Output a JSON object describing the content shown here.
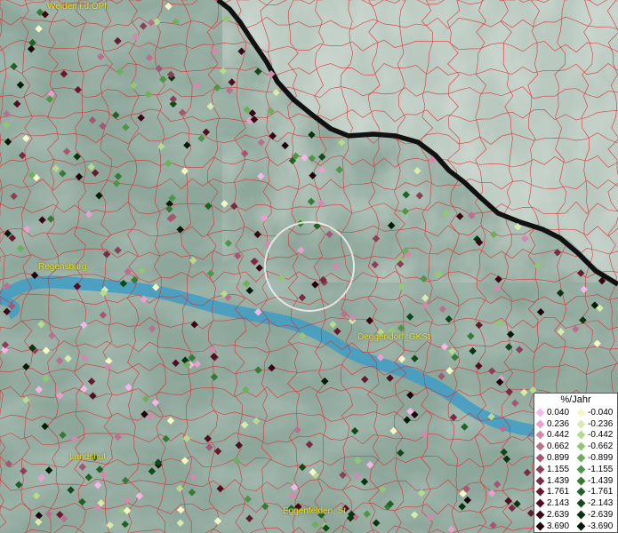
{
  "map": {
    "cities": [
      {
        "name": "Weiden i.d.OPf",
        "id": "weiden"
      },
      {
        "name": "Regensburg",
        "id": "regensburg"
      },
      {
        "name": "Deggendorf_GKSt",
        "id": "deggendorf"
      },
      {
        "name": "Landshut",
        "id": "landshut"
      },
      {
        "name": "Eggenfelden, St",
        "id": "eggenfelden"
      }
    ]
  },
  "legend": {
    "title": "%/Jahr",
    "positive": [
      {
        "label": "0.040",
        "color": "#f3b8e8"
      },
      {
        "label": "0.236",
        "color": "#e8a1cf"
      },
      {
        "label": "0.442",
        "color": "#d18aae"
      },
      {
        "label": "0.662",
        "color": "#bb6f8f"
      },
      {
        "label": "0.899",
        "color": "#a45672"
      },
      {
        "label": "1.155",
        "color": "#8e3f58"
      },
      {
        "label": "1.439",
        "color": "#7a2a42"
      },
      {
        "label": "1.761",
        "color": "#661a30"
      },
      {
        "label": "2.143",
        "color": "#500e20"
      },
      {
        "label": "2.639",
        "color": "#3a0614"
      },
      {
        "label": "3.690",
        "color": "#20020a"
      }
    ],
    "negative": [
      {
        "label": "-0.040",
        "color": "#f5f8c4"
      },
      {
        "label": "-0.236",
        "color": "#d9ebaa"
      },
      {
        "label": "-0.442",
        "color": "#b7db8c"
      },
      {
        "label": "-0.662",
        "color": "#93c774"
      },
      {
        "label": "-0.899",
        "color": "#6fae5b"
      },
      {
        "label": "-1.155",
        "color": "#4f9545"
      },
      {
        "label": "-1.439",
        "color": "#357b35"
      },
      {
        "label": "-1.761",
        "color": "#206226"
      },
      {
        "label": "-2.143",
        "color": "#114a18"
      },
      {
        "label": "-2.639",
        "color": "#08340e"
      },
      {
        "label": "-3.690",
        "color": "#021c06"
      }
    ]
  }
}
